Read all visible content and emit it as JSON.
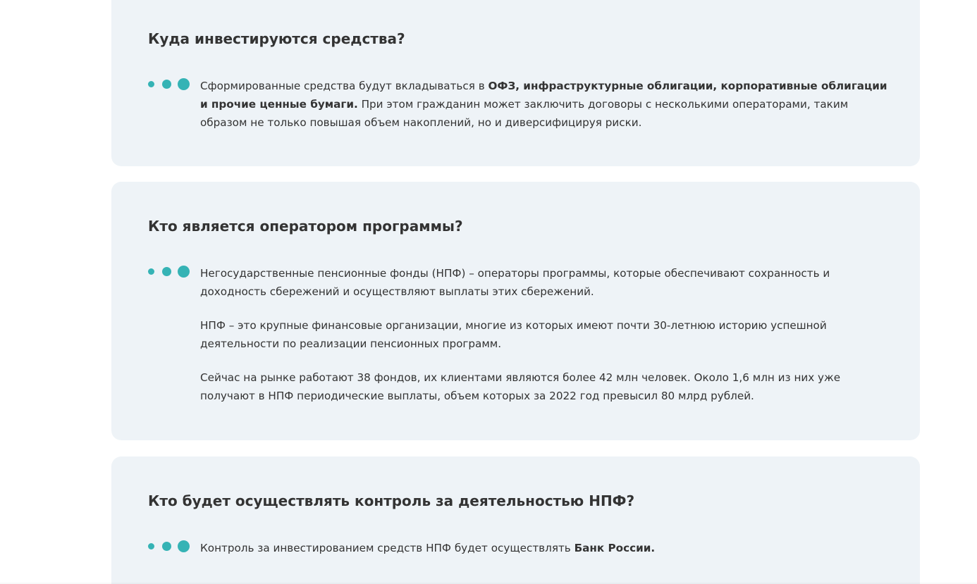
{
  "faq": [
    {
      "question": "Куда инвестируются средства?",
      "paragraphs": [
        [
          {
            "text": "Сформированные средства будут вкладываться в ",
            "bold": false
          },
          {
            "text": "ОФЗ, инфраструктурные облигации, корпоративные облигации и прочие ценные бумаги.",
            "bold": true
          },
          {
            "text": " При этом гражданин может заключить договоры с несколькими операторами, таким образом не только повышая объем накоплений, но и диверсифицируя риски.",
            "bold": false
          }
        ]
      ]
    },
    {
      "question": "Кто является оператором программы?",
      "paragraphs": [
        [
          {
            "text": "Негосударственные пенсионные фонды (НПФ) – операторы программы, которые обеспечивают сохранность и доходность сбережений и осуществляют выплаты этих сбережений.",
            "bold": false
          }
        ],
        [
          {
            "text": "НПФ – это крупные финансовые организации, многие из которых имеют почти 30-летнюю историю успешной деятельности по реализации пенсионных программ.",
            "bold": false
          }
        ],
        [
          {
            "text": "Сейчас на рынке работают 38 фондов, их клиентами являются более 42 млн человек. Около 1,6 млн из них уже получают в НПФ периодические выплаты, объем которых за 2022 год превысил 80 млрд рублей.",
            "bold": false
          }
        ]
      ]
    },
    {
      "question": "Кто будет осуществлять контроль за деятельностью НПФ?",
      "paragraphs": [
        [
          {
            "text": "Контроль за инвестированием средств НПФ будет осуществлять ",
            "bold": false
          },
          {
            "text": "Банк России.",
            "bold": true
          }
        ]
      ]
    }
  ],
  "colors": {
    "card_background": "#eef3f7",
    "accent_dots": "#35b3b5",
    "text": "#333333"
  },
  "icons": {
    "bullet": "three-dots-icon"
  }
}
